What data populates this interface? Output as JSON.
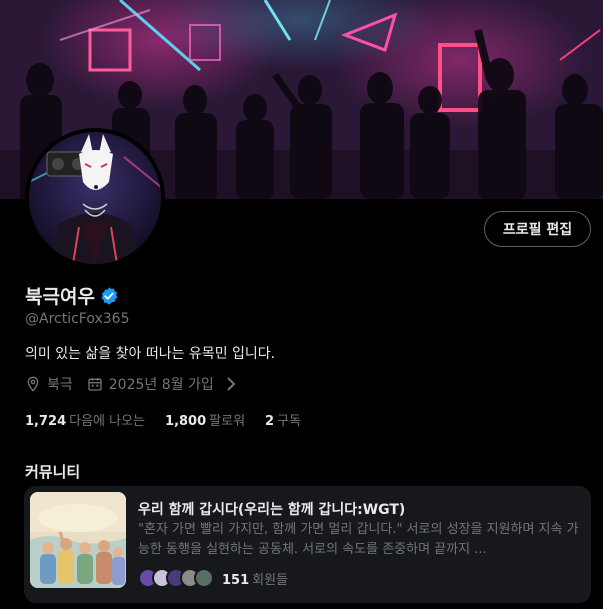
{
  "profile": {
    "display_name": "북극여우",
    "handle": "@ArcticFox365",
    "bio": "의미 있는 삶을 찾아 떠나는 유목민 입니다.",
    "location": "북극",
    "joined": "2025년 8월 가입",
    "edit_button_label": "프로필 편집",
    "verified_color": "#1d9bf0"
  },
  "stats": [
    {
      "value": "1,724",
      "label": "다음에 나오는"
    },
    {
      "value": "1,800",
      "label": "팔로워"
    },
    {
      "value": "2",
      "label": "구독"
    }
  ],
  "communities": {
    "section_title": "커뮤니티",
    "items": [
      {
        "name": "우리 함께 갑시다(우리는 함께 갑니다:WGT)",
        "description": "\"혼자 가면 빨리 가지만, 함께 가면 멀리 갑니다.\" 서로의 성장을 지원하며 지속 가능한 동행을 실현하는 공동체. 서로의 속도를 존중하며 끝까지 ...",
        "member_count": "151",
        "member_label": "회원들"
      }
    ]
  },
  "icons": {
    "verified": "verified-badge-icon",
    "location": "location-pin-icon",
    "calendar": "calendar-icon",
    "chevron": "chevron-right-icon"
  }
}
